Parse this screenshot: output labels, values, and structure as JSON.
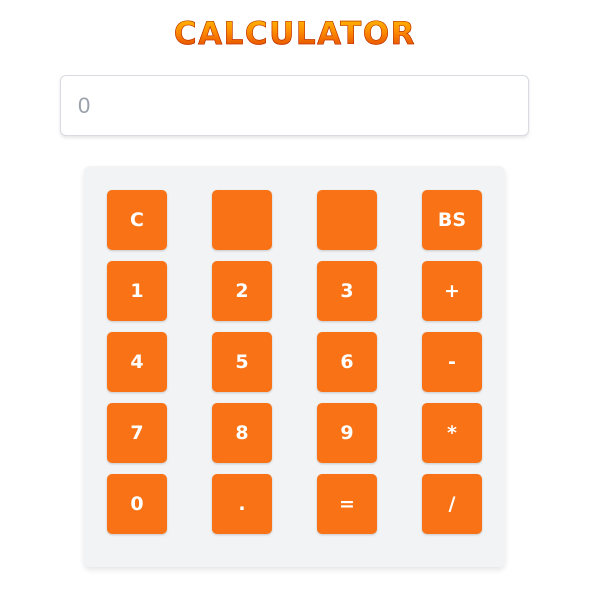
{
  "app": {
    "title": "CALCULATOR"
  },
  "display": {
    "value": "0"
  },
  "keypad": {
    "keys": [
      {
        "label": "C"
      },
      {
        "label": ""
      },
      {
        "label": ""
      },
      {
        "label": "BS"
      },
      {
        "label": "1"
      },
      {
        "label": "2"
      },
      {
        "label": "3"
      },
      {
        "label": "+"
      },
      {
        "label": "4"
      },
      {
        "label": "5"
      },
      {
        "label": "6"
      },
      {
        "label": "-"
      },
      {
        "label": "7"
      },
      {
        "label": "8"
      },
      {
        "label": "9"
      },
      {
        "label": "*"
      },
      {
        "label": "0"
      },
      {
        "label": "."
      },
      {
        "label": "="
      },
      {
        "label": "/"
      }
    ]
  },
  "colors": {
    "key": "#f97316",
    "key_text": "#ffffff",
    "pad_background": "#f2f3f5",
    "title_top": "#ffcc00",
    "title_bottom": "#d62a00"
  }
}
